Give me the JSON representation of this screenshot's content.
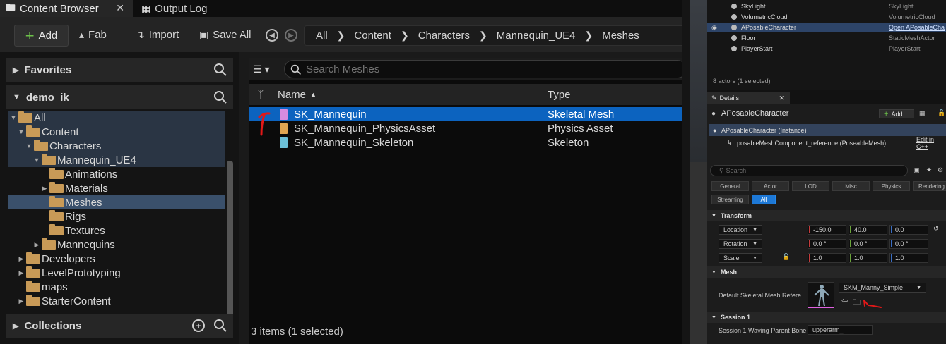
{
  "content_browser": {
    "tabs": [
      {
        "label": "Content Browser",
        "icon": "folder-search-icon"
      },
      {
        "label": "Output Log",
        "icon": "terminal-icon"
      }
    ],
    "toolbar": {
      "add_label": "Add",
      "fab_label": "Fab",
      "import_label": "Import",
      "save_all_label": "Save All"
    },
    "breadcrumb": [
      "All",
      "Content",
      "Characters",
      "Mannequin_UE4",
      "Meshes"
    ],
    "sidebar": {
      "favorites_label": "Favorites",
      "project_label": "demo_ik",
      "collections_label": "Collections",
      "tree": [
        {
          "label": "All",
          "depth": 0,
          "expanded": true
        },
        {
          "label": "Content",
          "depth": 1,
          "expanded": true
        },
        {
          "label": "Characters",
          "depth": 2,
          "expanded": true
        },
        {
          "label": "Mannequin_UE4",
          "depth": 3,
          "expanded": true
        },
        {
          "label": "Animations",
          "depth": 4,
          "expanded": null
        },
        {
          "label": "Materials",
          "depth": 4,
          "expanded": false
        },
        {
          "label": "Meshes",
          "depth": 4,
          "expanded": null,
          "selected": true
        },
        {
          "label": "Rigs",
          "depth": 4,
          "expanded": null
        },
        {
          "label": "Textures",
          "depth": 4,
          "expanded": null
        },
        {
          "label": "Mannequins",
          "depth": 3,
          "expanded": false
        },
        {
          "label": "Developers",
          "depth": 1,
          "expanded": false
        },
        {
          "label": "LevelPrototyping",
          "depth": 1,
          "expanded": false
        },
        {
          "label": "maps",
          "depth": 1,
          "expanded": null
        },
        {
          "label": "StarterContent",
          "depth": 1,
          "expanded": false
        }
      ]
    },
    "search_placeholder": "Search Meshes",
    "columns": {
      "name": "Name",
      "type": "Type"
    },
    "assets": [
      {
        "name": "SK_Mannequin",
        "type": "Skeletal Mesh",
        "color": "#d78be0",
        "selected": true
      },
      {
        "name": "SK_Mannequin_PhysicsAsset",
        "type": "Physics Asset",
        "color": "#e0a552",
        "selected": false
      },
      {
        "name": "SK_Mannequin_Skeleton",
        "type": "Skeleton",
        "color": "#6cc0d8",
        "selected": false
      }
    ],
    "status": "3 items (1 selected)"
  },
  "outliner": {
    "rows": [
      {
        "name": "SkyLight",
        "type": "SkyLight"
      },
      {
        "name": "VolumetricCloud",
        "type": "VolumetricCloud"
      },
      {
        "name": "APosableCharacter",
        "type": "Open APosableCha",
        "selected": true
      },
      {
        "name": "Floor",
        "type": "StaticMeshActor"
      },
      {
        "name": "PlayerStart",
        "type": "PlayerStart"
      }
    ],
    "count": "8 actors (1 selected)"
  },
  "details": {
    "tab_label": "Details",
    "actor_name": "APosableCharacter",
    "add_label": "Add",
    "instance_label": "APosableCharacter (Instance)",
    "component_label": "posableMeshComponent_reference (PoseableMesh)",
    "edit_link": "Edit in C++",
    "search_placeholder": "Search",
    "categories_row1": [
      "General",
      "Actor",
      "LOD",
      "Misc",
      "Physics",
      "Rendering"
    ],
    "categories_row2": [
      "Streaming",
      "All"
    ],
    "transform": {
      "header": "Transform",
      "location": {
        "label": "Location",
        "x": "-150.0",
        "y": "40.0",
        "z": "0.0"
      },
      "rotation": {
        "label": "Rotation",
        "x": "0.0 °",
        "y": "0.0 °",
        "z": "0.0 °"
      },
      "scale": {
        "label": "Scale",
        "x": "1.0",
        "y": "1.0",
        "z": "1.0"
      }
    },
    "mesh": {
      "header": "Mesh",
      "label": "Default Skeletal Mesh Refere",
      "value": "SKM_Manny_Simple"
    },
    "session": {
      "header": "Session 1",
      "label": "Session 1 Waving Parent Bone",
      "value": "upperarm_l"
    }
  }
}
